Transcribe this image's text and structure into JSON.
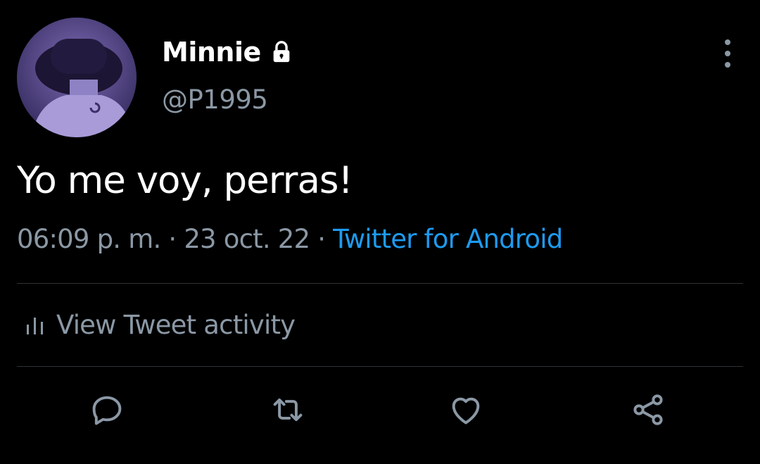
{
  "profile": {
    "display_name": "Minnie",
    "handle": "@P1995",
    "protected_icon": "lock-icon",
    "avatar_icon": "avatar-photo"
  },
  "tweet": {
    "text": "Yo me voy, perras!",
    "time": "06:09 p. m.",
    "separator": "·",
    "date": "23 oct. 22",
    "source": "Twitter for Android"
  },
  "activity": {
    "label": "View Tweet activity",
    "icon": "bar-chart-icon"
  },
  "actions": [
    {
      "name": "reply",
      "icon": "reply-icon"
    },
    {
      "name": "retweet",
      "icon": "retweet-icon"
    },
    {
      "name": "like",
      "icon": "heart-icon"
    },
    {
      "name": "share",
      "icon": "share-icon"
    }
  ],
  "menu": {
    "icon": "more-vertical-icon"
  },
  "colors": {
    "background": "#000000",
    "text_primary": "#ffffff",
    "text_secondary": "#8b98a5",
    "link": "#1d9bf0",
    "divider": "#2f3336"
  }
}
